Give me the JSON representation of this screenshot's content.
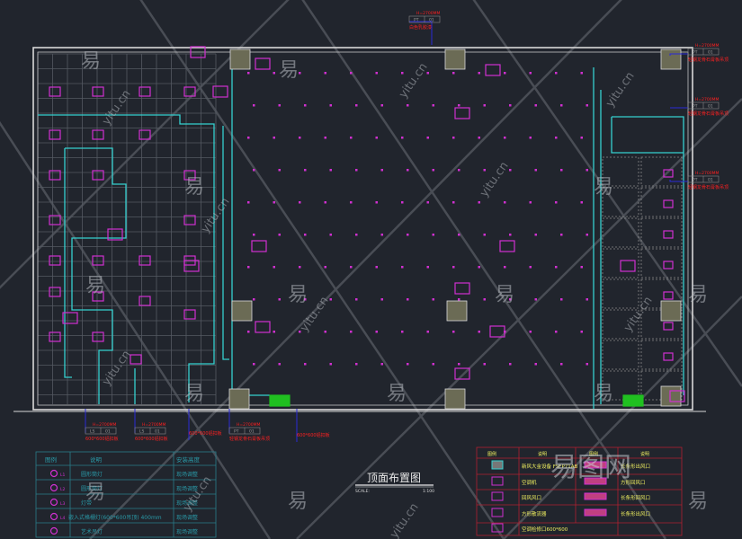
{
  "drawing": {
    "title": "顶面布置图",
    "scale_label": "SCALE:",
    "scale_value": "1:100",
    "colors": {
      "background": "#21252d",
      "wall": "#d9d9d9",
      "partition": "#35d0d0",
      "fixture": "#d030d0",
      "callout": "#ff2020",
      "leader": "#2020d0",
      "grid": "#5a5f66",
      "table_left": "#2a7d8a",
      "table_right": "#b02030",
      "text_yellow": "#f0f060"
    }
  },
  "callouts": [
    {
      "height": "H=2700MM",
      "codes": [
        "PT",
        "01"
      ],
      "note": "白色乳胶漆"
    },
    {
      "height": "H=2700MM",
      "codes": [
        "PT",
        "01"
      ],
      "note": "轻钢龙骨石膏板吊顶"
    },
    {
      "height": "H=2700MM",
      "codes": [
        "PT",
        "01"
      ],
      "note": "轻钢龙骨石膏板吊顶"
    },
    {
      "height": "H=2700MM",
      "codes": [
        "PT",
        "01"
      ],
      "note": "轻钢龙骨石膏板吊顶"
    },
    {
      "height": "H=2700MM",
      "codes": [
        "LS",
        "01"
      ],
      "note": "600*600铝扣板"
    },
    {
      "height": "H=2700MM",
      "codes": [
        "LS",
        "01"
      ],
      "note": "600*600铝扣板"
    },
    {
      "height": "",
      "codes": [],
      "note": "600*600铝扣板"
    },
    {
      "height": "H=2700MM",
      "codes": [
        "PT",
        "01"
      ],
      "note": "轻钢龙骨石膏板吊顶"
    },
    {
      "height": "",
      "codes": [],
      "note": "600*600铝扣板"
    }
  ],
  "legend_left": {
    "headers": [
      "图例",
      "说明",
      "安装高度"
    ],
    "rows": [
      {
        "icon": "round-downlight-icon",
        "tag": "L1",
        "desc": "圆形筒灯",
        "height": "现场调整"
      },
      {
        "icon": "small-downlight-icon",
        "tag": "L2",
        "desc": "圆形筒灯",
        "height": "现场调整"
      },
      {
        "icon": "light-strip-icon",
        "tag": "L3",
        "desc": "灯带",
        "height": "现场调整"
      },
      {
        "icon": "grille-light-icon",
        "tag": "L4",
        "desc": "嵌入式格栅灯(600*600吊顶) 400mm",
        "height": "现场调整"
      },
      {
        "icon": "art-pendant-icon",
        "tag": "",
        "desc": "艺术吊灯",
        "height": "现场调整"
      }
    ]
  },
  "legend_right": {
    "headers": [
      "图例",
      "说明",
      "图例",
      "说明"
    ],
    "rows": [
      {
        "left_icon": "fresh-air-unit-icon",
        "left_desc": "新风大金设备 FSFP71AB",
        "right_icon": "long-supply-vent-icon",
        "right_desc": "长条形出风口"
      },
      {
        "left_icon": "ac-unit-icon",
        "left_desc": "空调机",
        "right_icon": "square-vent-icon",
        "right_desc": "方形回风口"
      },
      {
        "left_icon": "return-vent-icon",
        "left_desc": "回风风口",
        "right_icon": "long-return-vent-icon",
        "right_desc": "长条形回风口"
      },
      {
        "left_icon": "square-diffuser-icon",
        "left_desc": "方形散流器",
        "right_icon": "double-vent-icon",
        "right_desc": "长条形出风口"
      },
      {
        "left_icon": "ac-access-panel-icon",
        "left_desc": "空调检修口600*600",
        "right_icon": "",
        "right_desc": ""
      }
    ]
  },
  "watermark": {
    "brand": "易图网",
    "domain": "yitu.cn",
    "glyph": "易"
  }
}
